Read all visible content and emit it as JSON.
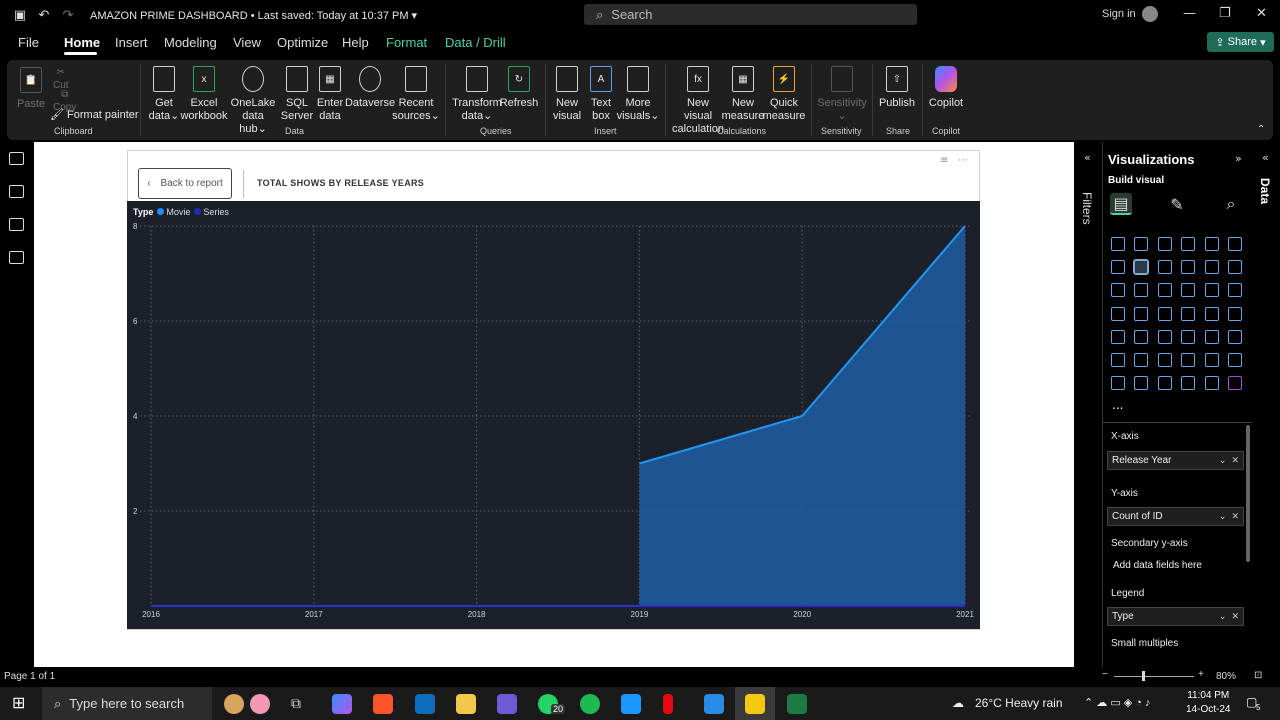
{
  "titlebar": {
    "app_title": "AMAZON PRIME DASHBOARD",
    "saved": "Last saved: Today at 10:37 PM",
    "search_placeholder": "Search",
    "signin": "Sign in"
  },
  "menu": {
    "file": "File",
    "home": "Home",
    "insert": "Insert",
    "modeling": "Modeling",
    "view": "View",
    "optimize": "Optimize",
    "help": "Help",
    "format": "Format",
    "data_drill": "Data / Drill",
    "share": "Share"
  },
  "ribbon": {
    "paste": "Paste",
    "cut": "Cut",
    "copy": "Copy",
    "format_painter": "Format painter",
    "clipboard": "Clipboard",
    "get_data": [
      "Get",
      "data"
    ],
    "excel": [
      "Excel",
      "workbook"
    ],
    "onelake": [
      "OneLake",
      "data hub"
    ],
    "sql": [
      "SQL",
      "Server"
    ],
    "enter_data": [
      "Enter",
      "data"
    ],
    "dataverse": "Dataverse",
    "recent": [
      "Recent",
      "sources"
    ],
    "data_group": "Data",
    "transform": [
      "Transform",
      "data"
    ],
    "refresh": "Refresh",
    "queries": "Queries",
    "new_visual": [
      "New",
      "visual"
    ],
    "text_box": [
      "Text",
      "box"
    ],
    "more_visuals": [
      "More",
      "visuals"
    ],
    "insert_group": "Insert",
    "new_calc": [
      "New visual",
      "calculation"
    ],
    "new_measure": [
      "New",
      "measure"
    ],
    "quick_measure": [
      "Quick",
      "measure"
    ],
    "calculations": "Calculations",
    "sensitivity": "Sensitivity",
    "sensitivity_group": "Sensitivity",
    "publish": "Publish",
    "share_group": "Share",
    "copilot": "Copilot",
    "copilot_group": "Copilot"
  },
  "report": {
    "back": "Back to report",
    "title": "TOTAL SHOWS BY RELEASE YEARS",
    "legend_title": "Type",
    "legend": [
      {
        "name": "Movie",
        "color": "#1f8fff"
      },
      {
        "name": "Series",
        "color": "#1e2db0"
      }
    ]
  },
  "chart_data": {
    "type": "area",
    "title": "TOTAL SHOWS BY RELEASE YEARS",
    "x": [
      "2016",
      "2017",
      "2018",
      "2019",
      "2020",
      "2021"
    ],
    "xlim": [
      2016,
      2021
    ],
    "ylim": [
      0,
      9
    ],
    "yticks": [
      2,
      4,
      6,
      8
    ],
    "grid": true,
    "legend_position": "top-left",
    "series": [
      {
        "name": "Movie",
        "color": "#2196f3",
        "fill": "#1d5ea3",
        "x": [
          2019,
          2020,
          2021
        ],
        "values": [
          3,
          4,
          8
        ]
      },
      {
        "name": "Series",
        "color": "#2a2fd0",
        "x": [
          2016,
          2017,
          2018,
          2019,
          2020,
          2021
        ],
        "values": [
          0,
          0,
          0,
          0,
          0,
          0
        ]
      }
    ]
  },
  "panes": {
    "filters": "Filters",
    "visualizations": "Visualizations",
    "build_visual": "Build visual",
    "data": "Data",
    "more": "...",
    "x_axis": "X-axis",
    "x_field": "Release Year",
    "y_axis": "Y-axis",
    "y_field": "Count of ID",
    "secondary_y": "Secondary y-axis",
    "secondary_y_placeholder": "Add data fields here",
    "legend": "Legend",
    "legend_field": "Type",
    "small_multiples": "Small multiples"
  },
  "status": {
    "page": "Page 1 of 1",
    "zoom": "80%"
  },
  "taskbar": {
    "search": "Type here to search",
    "whatsapp_badge": "20",
    "weather": "26°C  Heavy rain",
    "time": "11:04 PM",
    "date": "14-Oct-24",
    "notif": "5"
  }
}
